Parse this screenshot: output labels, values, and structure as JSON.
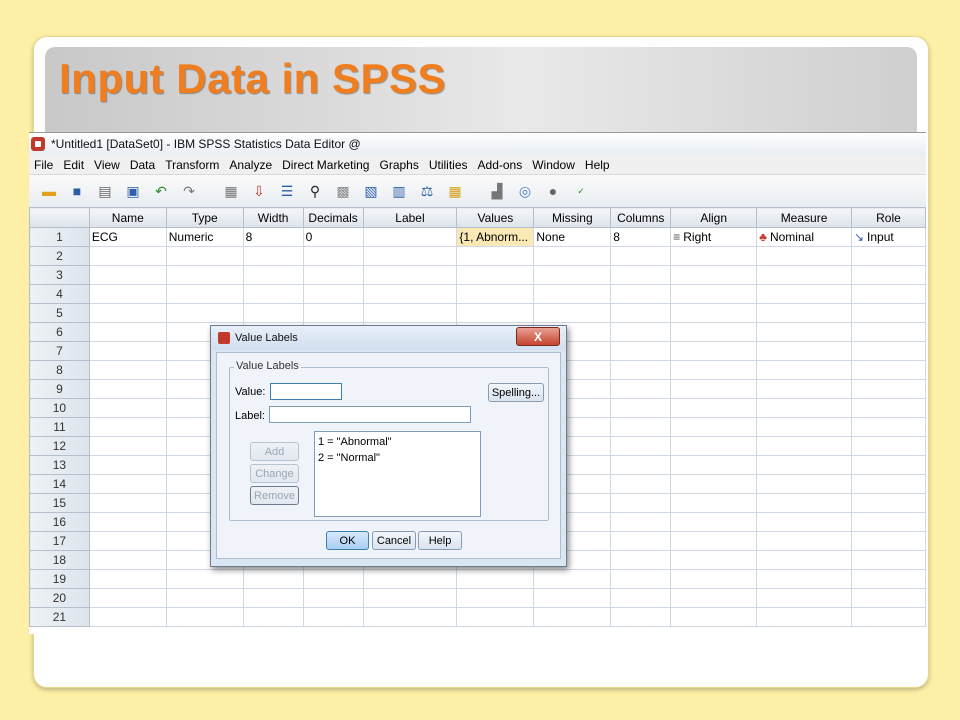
{
  "slide": {
    "title": "Input Data in SPSS"
  },
  "window": {
    "title": "*Untitled1 [DataSet0] - IBM SPSS Statistics Data Editor @"
  },
  "menu": [
    "File",
    "Edit",
    "View",
    "Data",
    "Transform",
    "Analyze",
    "Direct Marketing",
    "Graphs",
    "Utilities",
    "Add-ons",
    "Window",
    "Help"
  ],
  "toolbar_icons": [
    "open-folder-icon",
    "save-icon",
    "print-icon",
    "recall-dialog-icon",
    "undo-icon",
    "redo-icon",
    "goto-case-icon",
    "goto-variable-icon",
    "variables-icon",
    "find-icon",
    "insert-cases-icon",
    "insert-variable-icon",
    "split-file-icon",
    "weight-cases-icon",
    "select-cases-icon",
    "value-labels-icon",
    "use-sets-icon",
    "show-all-variables-icon",
    "spell-check-icon"
  ],
  "grid": {
    "columns": [
      "Name",
      "Type",
      "Width",
      "Decimals",
      "Label",
      "Values",
      "Missing",
      "Columns",
      "Align",
      "Measure",
      "Role"
    ],
    "row1": {
      "num": "1",
      "name": "ECG",
      "type": "Numeric",
      "width": "8",
      "decimals": "0",
      "label": "",
      "values": "{1, Abnorm...",
      "missing": "None",
      "columns": "8",
      "align": "Right",
      "measure": "Nominal",
      "role": "Input"
    },
    "row_numbers": [
      "2",
      "3",
      "4",
      "5",
      "6",
      "7",
      "8",
      "9",
      "10",
      "11",
      "12",
      "13",
      "14",
      "15",
      "16",
      "17",
      "18",
      "19",
      "20",
      "21"
    ]
  },
  "dialog": {
    "title": "Value Labels",
    "close": "X",
    "group_label": "Value Labels",
    "value_label": "Value:",
    "value_input": "",
    "label_label": "Label:",
    "label_input": "",
    "spelling_button": "Spelling...",
    "add_button": "Add",
    "change_button": "Change",
    "remove_button": "Remove",
    "list_items": [
      "1 = \"Abnormal\"",
      "2 = \"Normal\""
    ],
    "ok_button": "OK",
    "cancel_button": "Cancel",
    "help_button": "Help"
  },
  "colors": {
    "slide_background": "#fdf0a6",
    "title_orange": "#f07e1e",
    "selected_cell": "#fbe9b5"
  }
}
